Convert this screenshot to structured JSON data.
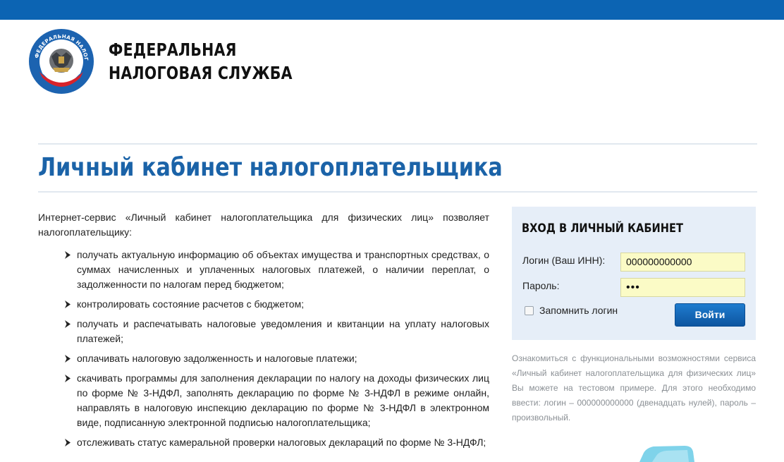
{
  "header": {
    "brand_line1": "ФЕДЕРАЛЬНАЯ",
    "brand_line2": "НАЛОГОВАЯ СЛУЖБА",
    "logo_icon": "fns-emblem-icon",
    "logo_text": "ФЕДЕРАЛЬНАЯ НАЛОГОВАЯ СЛУЖБА",
    "bar_color": "#0c64b3"
  },
  "main": {
    "title": "Личный кабинет налогоплательщика",
    "intro": "Интернет-сервис «Личный кабинет налогоплательщика для физических лиц» позволяет налогоплательщику:",
    "features": [
      "получать актуальную информацию об объектах имущества и транспортных средствах, о суммах начисленных и уплаченных налоговых платежей, о наличии переплат, о задолженности по налогам перед бюджетом;",
      "контролировать состояние расчетов с бюджетом;",
      "получать и распечатывать налоговые уведомления и квитанции на уплату налоговых платежей;",
      "оплачивать налоговую задолженность и налоговые платежи;",
      "скачивать программы для заполнения декларации по налогу на доходы физических лиц по форме № 3-НДФЛ, заполнять декларацию по форме № 3-НДФЛ в режиме онлайн, направлять в налоговую инспекцию декларацию по форме № 3-НДФЛ в электронном виде, подписанную электронной подписью налогоплательщика;",
      "отслеживать статус камеральной проверки налоговых деклараций по форме № 3-НДФЛ;"
    ]
  },
  "login": {
    "title": "ВХОД В ЛИЧНЫЙ КАБИНЕТ",
    "login_label": "Логин (Ваш ИНН):",
    "login_value": "000000000000",
    "password_label": "Пароль:",
    "password_value": "•••",
    "remember_label": "Запомнить логин",
    "remember_checked": false,
    "submit_label": "Войти"
  },
  "promo": {
    "text": "Ознакомиться с функциональными возможностями сервиса «Личный кабинет налогоплательщика для физических лиц» Вы можете на тестовом примере. Для этого необходимо ввести: логин – 000000000000 (двенадцать нулей), пароль – произвольный."
  }
}
